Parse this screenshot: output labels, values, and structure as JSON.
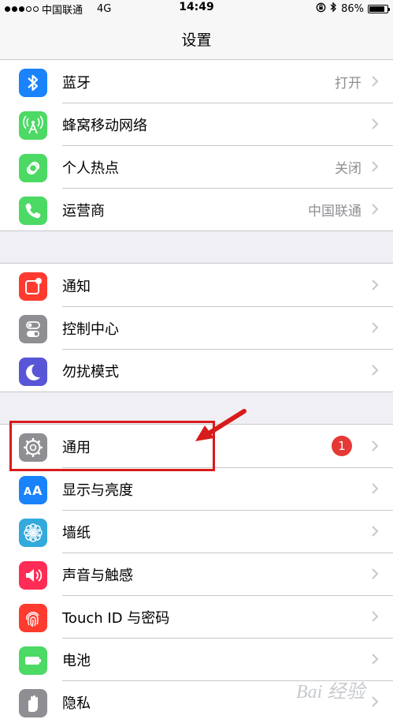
{
  "status_bar": {
    "carrier": "中国联通",
    "network": "4G",
    "time": "14:49",
    "battery": "86%",
    "battery_level": 0.86
  },
  "nav": {
    "title": "设置"
  },
  "groups": [
    [
      {
        "label": "蓝牙",
        "value": "打开",
        "icon": "bluetooth-icon",
        "color": "#1a82fb"
      },
      {
        "label": "蜂窝移动网络",
        "value": "",
        "icon": "cellular-antenna-icon",
        "color": "#4cd964"
      },
      {
        "label": "个人热点",
        "value": "关闭",
        "icon": "hotspot-link-icon",
        "color": "#4cd964"
      },
      {
        "label": "运营商",
        "value": "中国联通",
        "icon": "phone-icon",
        "color": "#4cd964"
      }
    ],
    [
      {
        "label": "通知",
        "value": "",
        "icon": "notifications-icon",
        "color": "#ff3b30"
      },
      {
        "label": "控制中心",
        "value": "",
        "icon": "control-center-icon",
        "color": "#8e8e93"
      },
      {
        "label": "勿扰模式",
        "value": "",
        "icon": "moon-icon",
        "color": "#5856d6"
      }
    ],
    [
      {
        "label": "通用",
        "value": "",
        "badge": "1",
        "icon": "gear-icon",
        "color": "#8e8e93"
      },
      {
        "label": "显示与亮度",
        "value": "",
        "icon": "display-aa-icon",
        "color": "#1a82fb"
      },
      {
        "label": "墙纸",
        "value": "",
        "icon": "wallpaper-flower-icon",
        "color": "#34aadc"
      },
      {
        "label": "声音与触感",
        "value": "",
        "icon": "speaker-icon",
        "color": "#ff2d55"
      },
      {
        "label": "Touch ID 与密码",
        "value": "",
        "icon": "fingerprint-icon",
        "color": "#ff3b30"
      },
      {
        "label": "电池",
        "value": "",
        "icon": "battery-icon",
        "color": "#4cd964"
      },
      {
        "label": "隐私",
        "value": "",
        "icon": "hand-icon",
        "color": "#8e8e93"
      }
    ]
  ],
  "watermark": {
    "text": "Bai 经验"
  }
}
